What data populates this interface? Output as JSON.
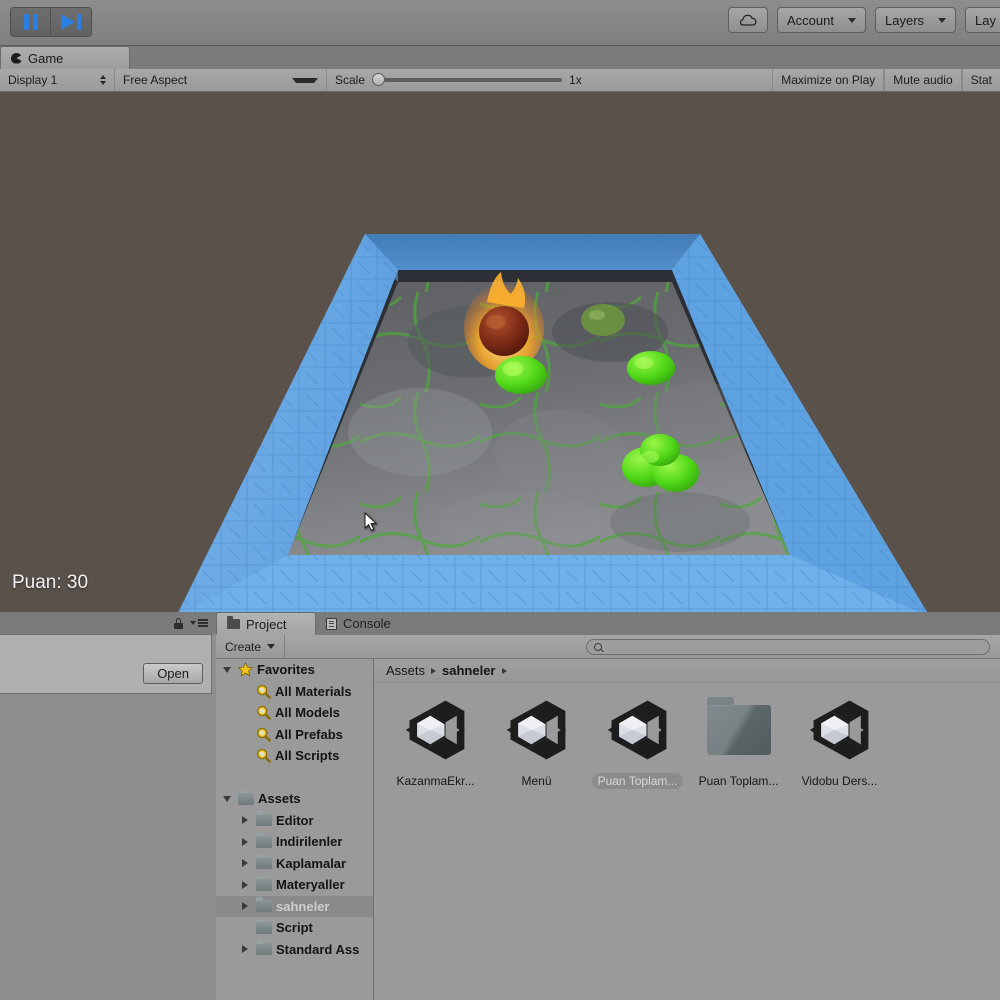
{
  "toolbar": {
    "pause_button": "pause-icon",
    "step_button": "step-icon",
    "cloud_button": "cloud-icon",
    "account_label": "Account",
    "layers_label": "Layers",
    "layout_label": "Lay"
  },
  "game_view": {
    "tab_label": "Game",
    "tab_icon": "game-pacman-icon",
    "display_label": "Display 1",
    "aspect_label": "Free Aspect",
    "scale_label": "Scale",
    "scale_value": "1x",
    "maximize_label": "Maximize on Play",
    "mute_label": "Mute audio",
    "stats_label": "Stat",
    "score_text": "Puan: 30",
    "background_color": "#5a514b",
    "arena_color": "#4f9ae0"
  },
  "inspector": {
    "open_label": "Open",
    "lock_icon": "lock-icon",
    "menu_icon": "hamburger-menu-icon"
  },
  "project_panel": {
    "tabs": [
      {
        "label": "Project",
        "icon": "folder-icon",
        "active": true
      },
      {
        "label": "Console",
        "icon": "console-icon",
        "active": false
      }
    ],
    "create_label": "Create",
    "search_value": "",
    "search_placeholder": "",
    "breadcrumb": [
      {
        "label": "Assets",
        "current": false
      },
      {
        "label": "sahneler",
        "current": true
      }
    ],
    "tree": [
      {
        "label": "Favorites",
        "indent": 0,
        "twisty": "down",
        "icon": "star-icon",
        "selected": false
      },
      {
        "label": "All Materials",
        "indent": 1,
        "twisty": "none",
        "icon": "search-icon",
        "selected": false
      },
      {
        "label": "All Models",
        "indent": 1,
        "twisty": "none",
        "icon": "search-icon",
        "selected": false
      },
      {
        "label": "All Prefabs",
        "indent": 1,
        "twisty": "none",
        "icon": "search-icon",
        "selected": false
      },
      {
        "label": "All Scripts",
        "indent": 1,
        "twisty": "none",
        "icon": "search-icon",
        "selected": false
      },
      {
        "label": "",
        "indent": 0,
        "twisty": "none",
        "icon": "none",
        "selected": false
      },
      {
        "label": "Assets",
        "indent": 0,
        "twisty": "down",
        "icon": "folder-icon",
        "selected": false
      },
      {
        "label": "Editor",
        "indent": 1,
        "twisty": "right",
        "icon": "folder-icon",
        "selected": false
      },
      {
        "label": "Indirilenler",
        "indent": 1,
        "twisty": "right",
        "icon": "folder-icon",
        "selected": false
      },
      {
        "label": "Kaplamalar",
        "indent": 1,
        "twisty": "right",
        "icon": "folder-icon",
        "selected": false
      },
      {
        "label": "Materyaller",
        "indent": 1,
        "twisty": "right",
        "icon": "folder-icon",
        "selected": false
      },
      {
        "label": "sahneler",
        "indent": 1,
        "twisty": "right",
        "icon": "folder-icon",
        "selected": true
      },
      {
        "label": "Script",
        "indent": 1,
        "twisty": "none",
        "icon": "folder-icon",
        "selected": false
      },
      {
        "label": "Standard Ass",
        "indent": 1,
        "twisty": "right",
        "icon": "folder-icon",
        "selected": false
      }
    ],
    "assets": [
      {
        "name": "KazanmaEkr...",
        "icon": "unity-scene-icon",
        "selected": false
      },
      {
        "name": "Menü",
        "icon": "unity-scene-icon",
        "selected": false
      },
      {
        "name": "Puan Toplam...",
        "icon": "unity-scene-icon",
        "selected": true
      },
      {
        "name": "Puan Toplam...",
        "icon": "folder-icon",
        "selected": false
      },
      {
        "name": "Vidobu Ders...",
        "icon": "unity-scene-icon",
        "selected": false
      }
    ]
  }
}
